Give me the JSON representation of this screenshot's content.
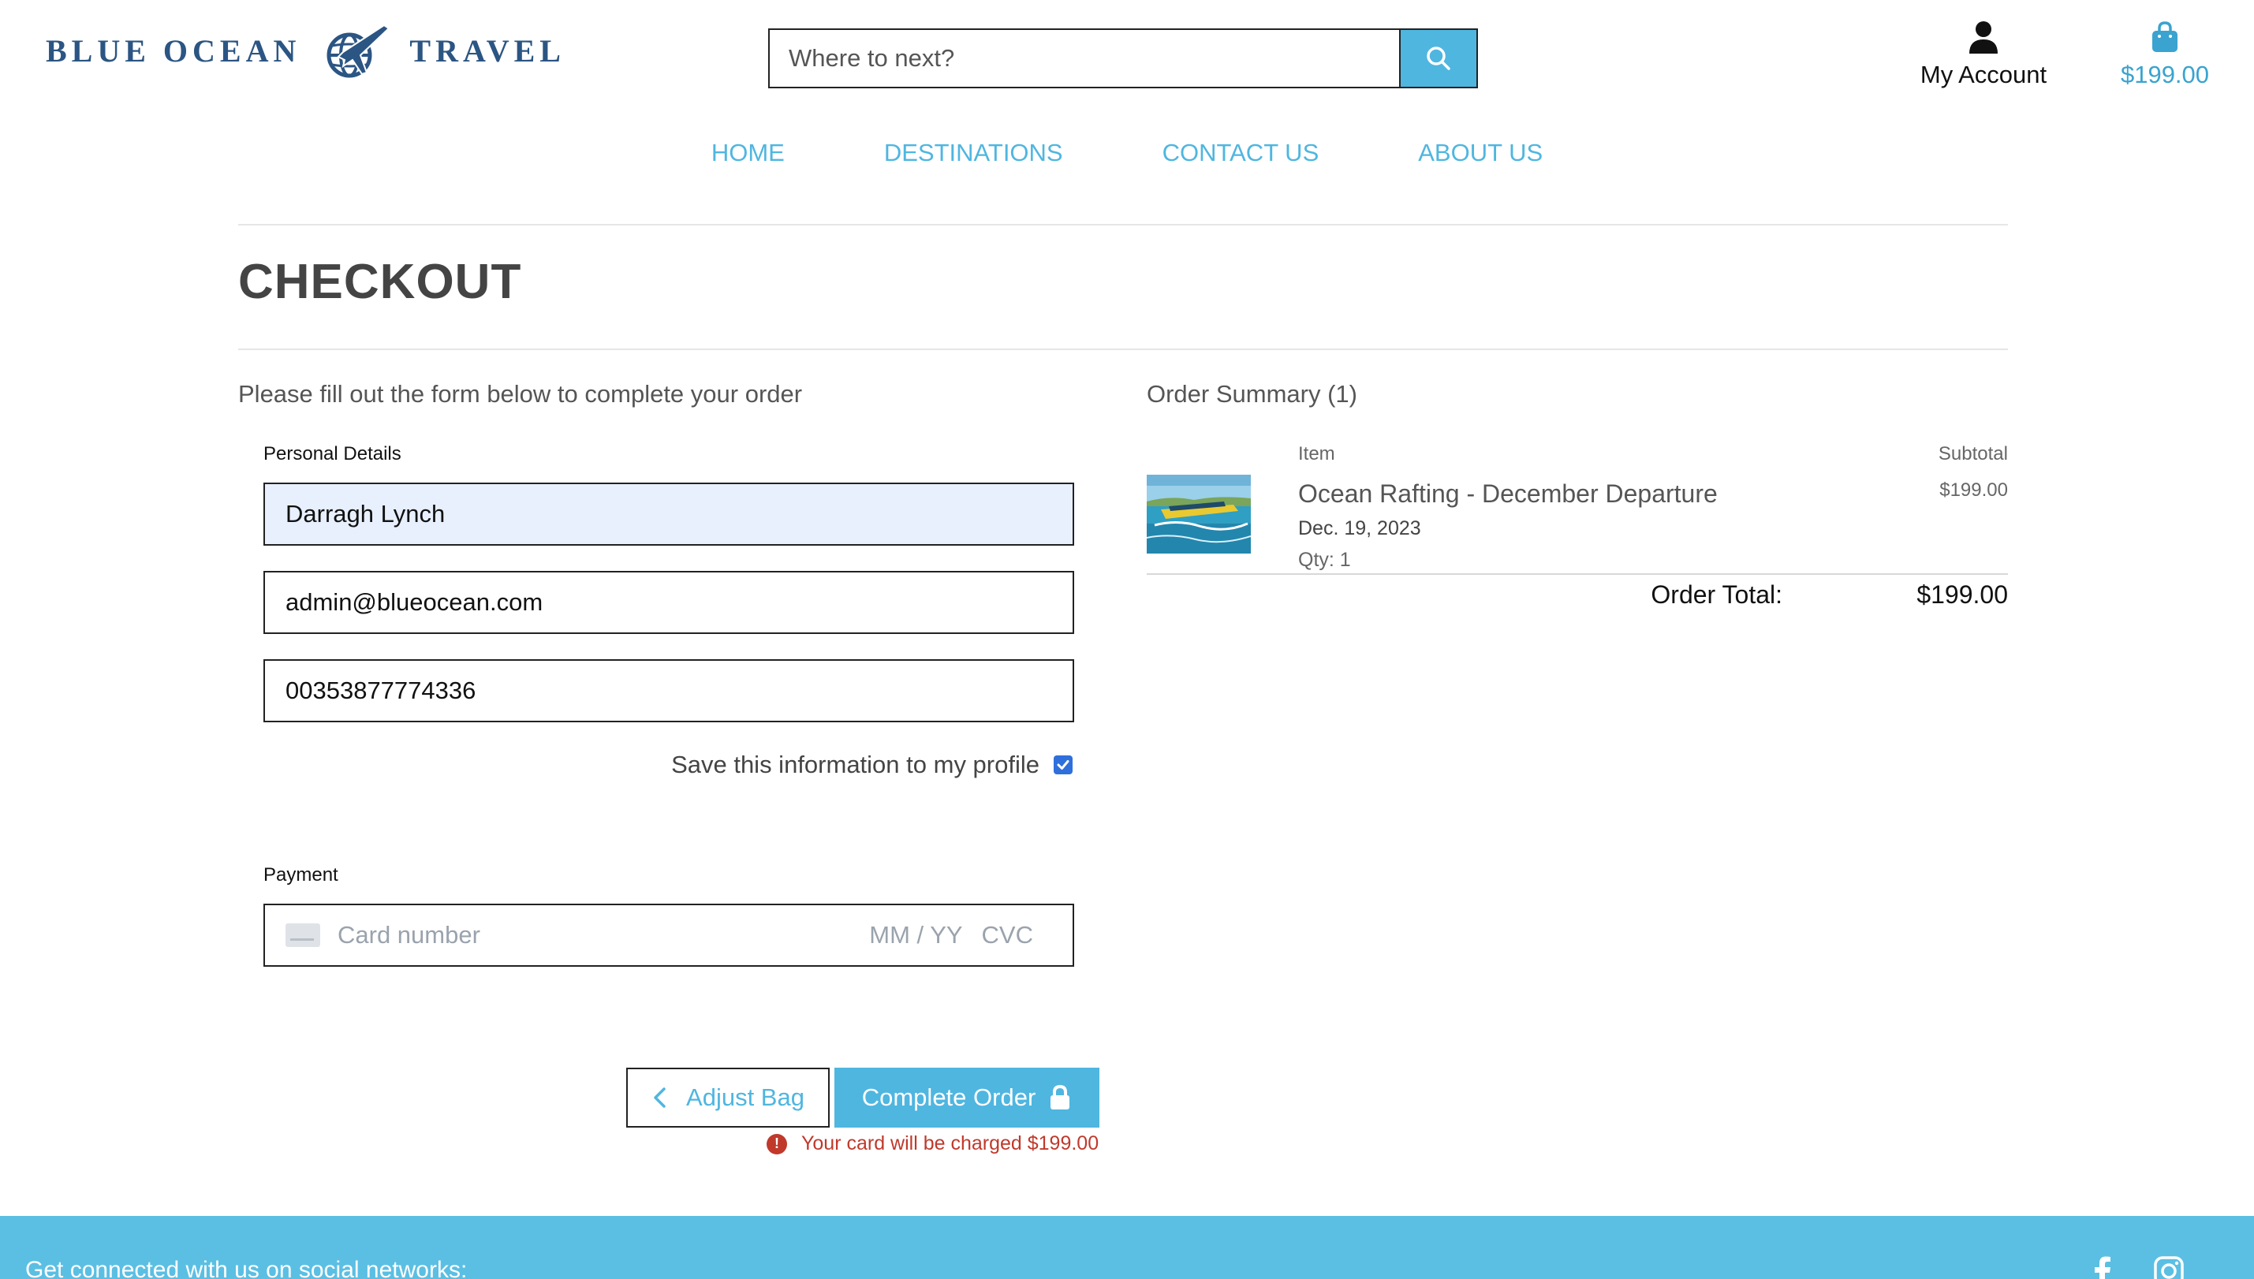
{
  "header": {
    "logo_left": "BLUE OCEAN",
    "logo_right": "TRAVEL",
    "search_placeholder": "Where to next?",
    "account_label": "My Account",
    "bag_total": "$199.00"
  },
  "nav": {
    "home": "HOME",
    "destinations": "DESTINATIONS",
    "contact": "CONTACT US",
    "about": "ABOUT US"
  },
  "page": {
    "title": "CHECKOUT",
    "form_intro": "Please fill out the form below to complete your order"
  },
  "personal": {
    "label": "Personal Details",
    "full_name": "Darragh Lynch",
    "email": "admin@blueocean.com",
    "phone": "00353877774336",
    "save_label": "Save this information to my profile",
    "save_checked": true
  },
  "payment": {
    "label": "Payment",
    "card_placeholder": "Card number",
    "expiry_placeholder": "MM / YY",
    "cvc_placeholder": "CVC"
  },
  "actions": {
    "adjust_label": "Adjust Bag",
    "complete_label": "Complete Order",
    "charge_note": "Your card will be charged $199.00"
  },
  "summary": {
    "title": "Order Summary (1)",
    "col_item": "Item",
    "col_subtotal": "Subtotal",
    "items": [
      {
        "name": "Ocean Rafting - December Departure",
        "date": "Dec. 19, 2023",
        "qty": "Qty: 1",
        "subtotal": "$199.00"
      }
    ],
    "total_label": "Order Total:",
    "total_value": "$199.00"
  },
  "footer": {
    "social_text": "Get connected with us on social networks:"
  },
  "colors": {
    "accent": "#4fb6e0",
    "brand": "#2b5583",
    "footer": "#5bbfe3",
    "error": "#c0392b"
  },
  "icons": [
    "search-icon",
    "user-icon",
    "shopping-bag-icon",
    "chevron-left-icon",
    "lock-icon",
    "warning-icon",
    "credit-card-icon",
    "facebook-icon",
    "instagram-icon"
  ]
}
